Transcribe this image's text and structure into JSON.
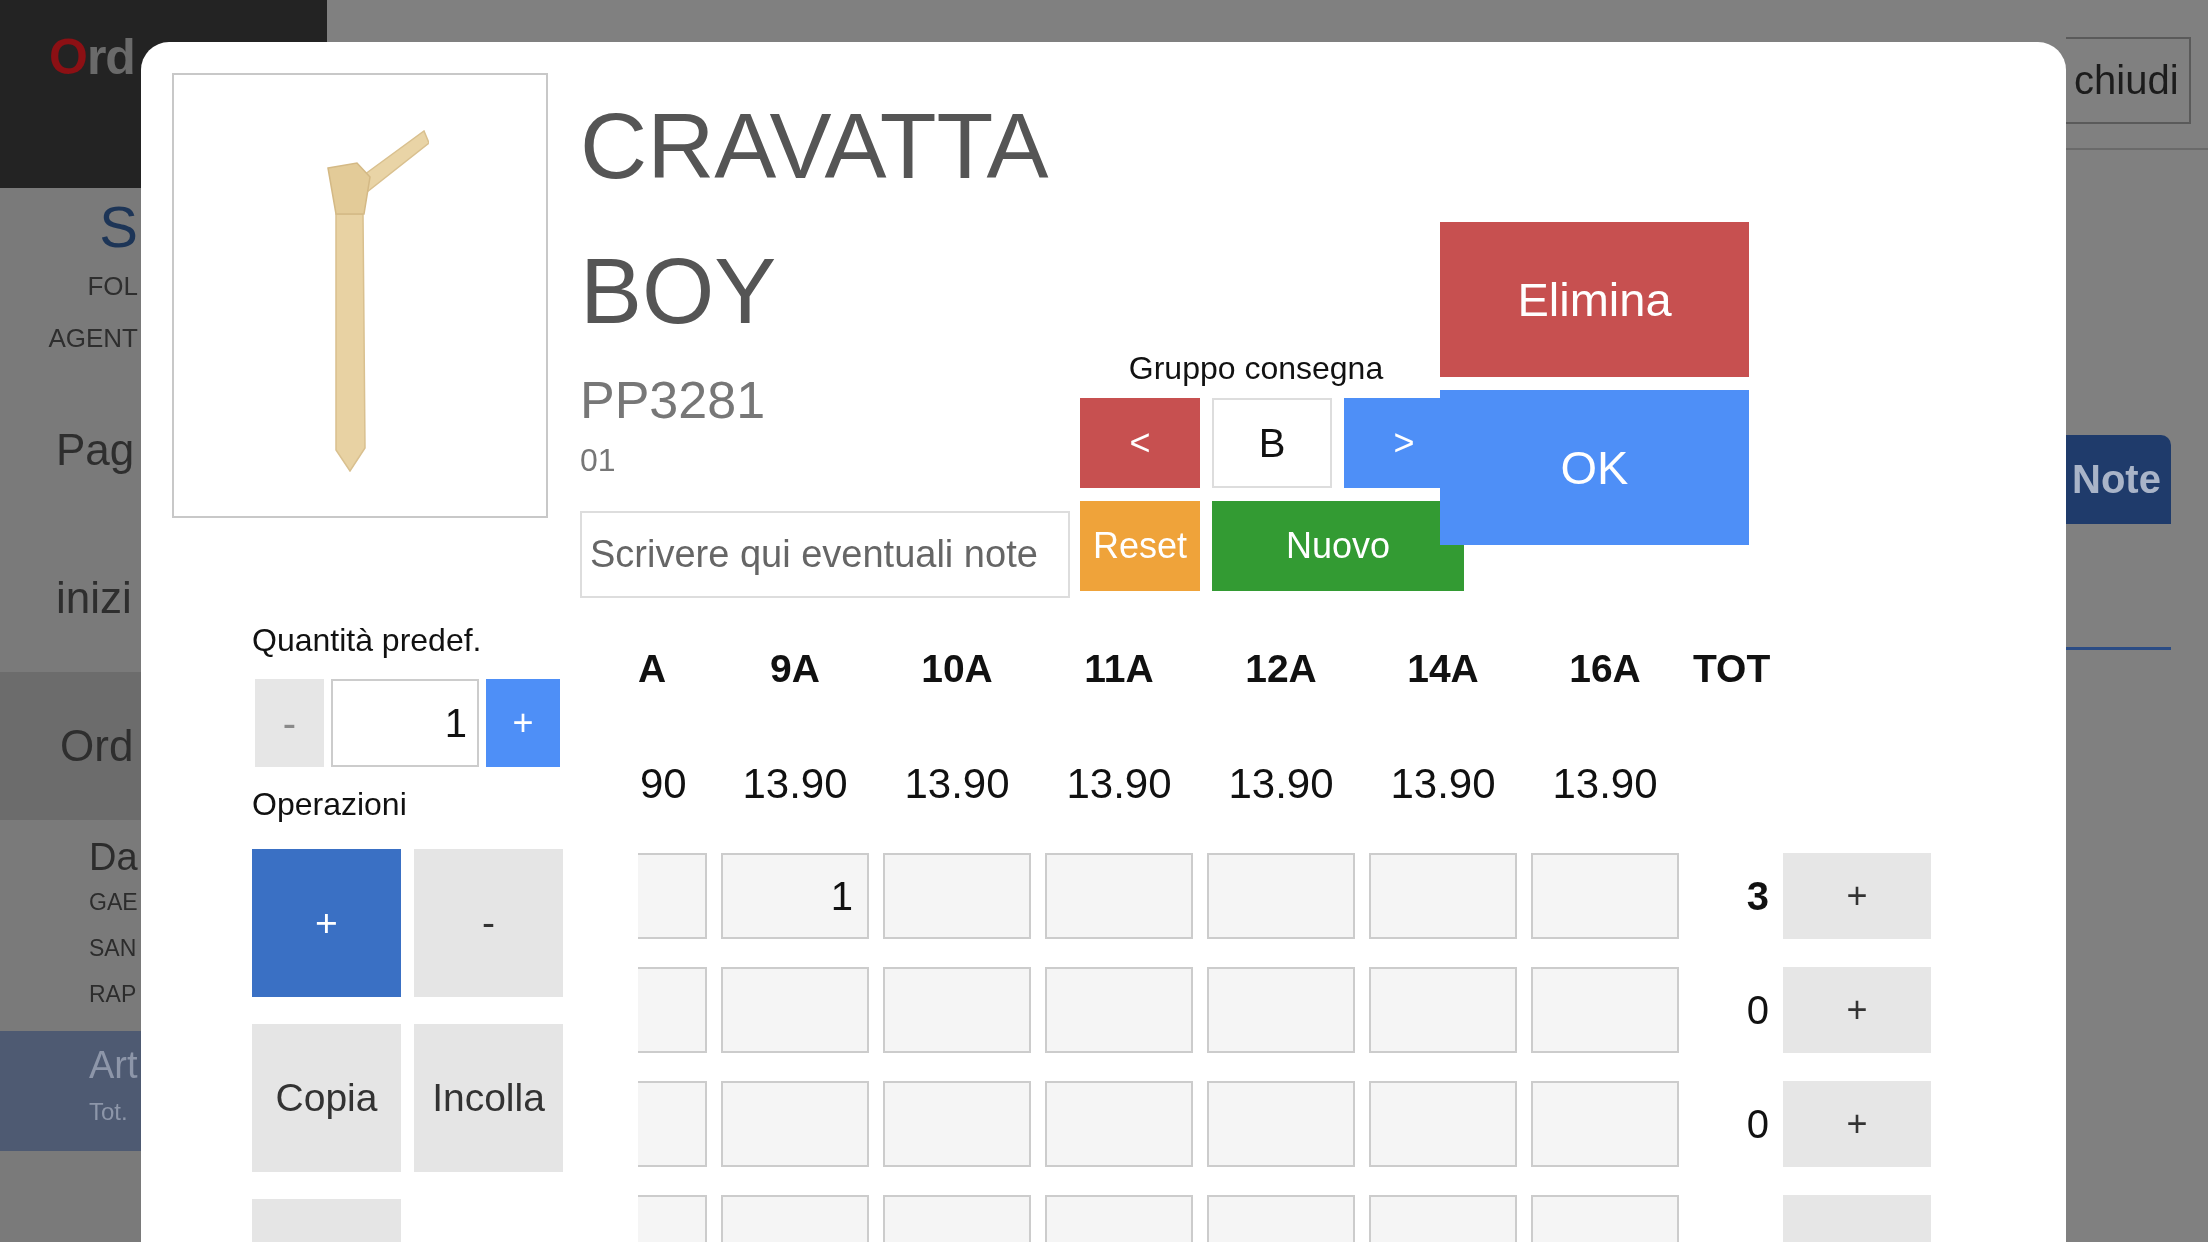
{
  "sidebar": {
    "logo": "Ord",
    "user": {
      "initial": "S",
      "lines": [
        "FOL",
        "AGENT"
      ]
    },
    "nav": [
      {
        "kind": "link",
        "label": "Pag"
      },
      {
        "kind": "link",
        "label": "inizi"
      },
      {
        "kind": "section",
        "label": "Ord"
      }
    ],
    "orders": [
      {
        "title": "Da",
        "lines": [
          "GAE",
          "SAN",
          "RAP"
        ],
        "selected": false
      },
      {
        "title": "Art",
        "lines": [
          "Tot."
        ],
        "selected": true
      }
    ]
  },
  "header": {
    "close_button": "chiudi",
    "tabs": [
      {
        "label": "Note",
        "selected": true
      }
    ]
  },
  "dialog": {
    "product": {
      "name": "CRAVATTA BOY",
      "code": "PP3281",
      "variant": "01"
    },
    "notes": {
      "placeholder": "Scrivere qui eventuali note"
    },
    "delivery_group": {
      "label": "Gruppo consegna",
      "previous": "<",
      "value": "B",
      "next": ">"
    },
    "reset_button": "Reset",
    "new_button": "Nuovo",
    "delete_button": "Elimina",
    "ok_button": "OK",
    "default_quantity": {
      "label": "Quantità predef.",
      "decrease": "-",
      "decrease_disabled": true,
      "value": "1",
      "increase": "+"
    },
    "operations": {
      "label": "Operazioni",
      "modes": [
        {
          "label": "+",
          "selected": true
        },
        {
          "label": "-",
          "selected": false
        }
      ],
      "tools": [
        {
          "kind": "text",
          "label": "Copia"
        },
        {
          "kind": "text",
          "label": "Incolla"
        },
        {
          "kind": "blank"
        }
      ]
    },
    "sizes": {
      "columns": [
        {
          "label": "A",
          "price": "90",
          "cut_off": true
        },
        {
          "label": "9A",
          "price": "13.90",
          "cut_off": false
        },
        {
          "label": "10A",
          "price": "13.90",
          "cut_off": false
        },
        {
          "label": "11A",
          "price": "13.90",
          "cut_off": false
        },
        {
          "label": "12A",
          "price": "13.90",
          "cut_off": false
        },
        {
          "label": "14A",
          "price": "13.90",
          "cut_off": false
        },
        {
          "label": "16A",
          "price": "13.90",
          "cut_off": false
        }
      ],
      "total_label": "TOT",
      "rows": [
        {
          "cells": [
            null,
            "1",
            null,
            null,
            null,
            null,
            null
          ],
          "total": "3",
          "total_bold": true,
          "add": "+"
        },
        {
          "cells": [
            null,
            null,
            null,
            null,
            null,
            null,
            null
          ],
          "total": "0",
          "total_bold": false,
          "add": "+"
        },
        {
          "cells": [
            null,
            null,
            null,
            null,
            null,
            null,
            null
          ],
          "total": "0",
          "total_bold": false,
          "add": "+"
        },
        {
          "cells": [
            null,
            null,
            null,
            null,
            null,
            null,
            null
          ]
        }
      ]
    }
  }
}
